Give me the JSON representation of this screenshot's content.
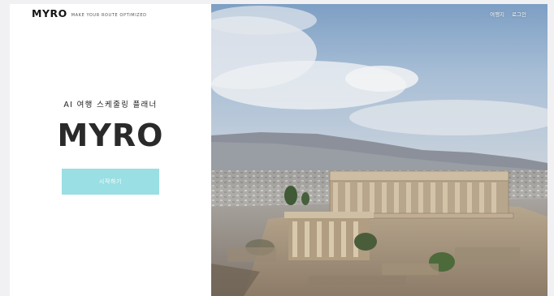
{
  "brand": {
    "logo": "MYRO",
    "tagline": "MAKE YOUR ROUTE OPTIMIZED"
  },
  "nav": {
    "items": [
      "여행지",
      "로그인"
    ]
  },
  "hero": {
    "subtitle": "AI 여행 스케줄링 플래너",
    "title": "MYRO",
    "button_label": "시작하기"
  },
  "colors": {
    "accent": "#9adfe3",
    "text": "#2a2a2a"
  }
}
